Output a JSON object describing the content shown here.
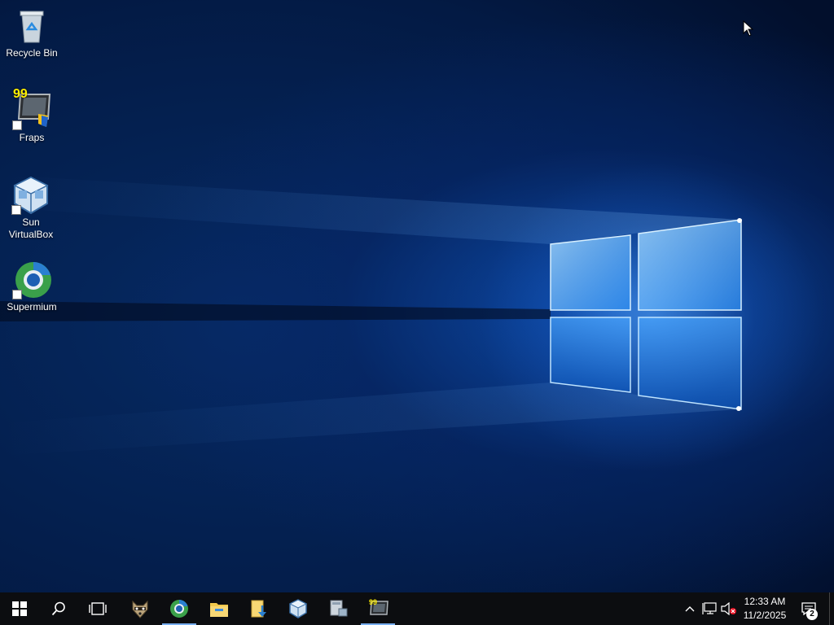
{
  "desktop": {
    "icons": [
      {
        "label": "Recycle Bin",
        "icon": "recycle-bin-icon"
      },
      {
        "label": "Fraps",
        "icon": "fraps-icon",
        "badge_text": "99"
      },
      {
        "label": "Sun VirtualBox",
        "icon": "virtualbox-icon"
      },
      {
        "label": "Supermium",
        "icon": "supermium-icon"
      }
    ]
  },
  "taskbar": {
    "start": {
      "icon": "windows-start-icon"
    },
    "search": {
      "icon": "search-icon"
    },
    "task_view": {
      "icon": "task-view-icon"
    },
    "pinned": [
      {
        "icon": "raccoon-app-icon"
      },
      {
        "icon": "supermium-icon",
        "active": true
      },
      {
        "icon": "file-explorer-icon"
      },
      {
        "icon": "downloads-folder-icon"
      },
      {
        "icon": "virtualbox-icon"
      },
      {
        "icon": "computer-icon"
      },
      {
        "icon": "fraps-icon",
        "active": true,
        "badge_text": "99"
      }
    ],
    "tray": {
      "chevron": "chevron-up-icon",
      "network": "network-icon",
      "volume": "volume-muted-icon",
      "time": "12:33 AM",
      "date": "11/2/2025",
      "notifications_icon": "action-center-icon",
      "notifications_count": "2"
    }
  },
  "colors": {
    "taskbar": "#0c0d10",
    "accent": "#78aef0",
    "wallpaper_dark": "#031a44",
    "wallpaper_glow": "#5aaaff"
  }
}
